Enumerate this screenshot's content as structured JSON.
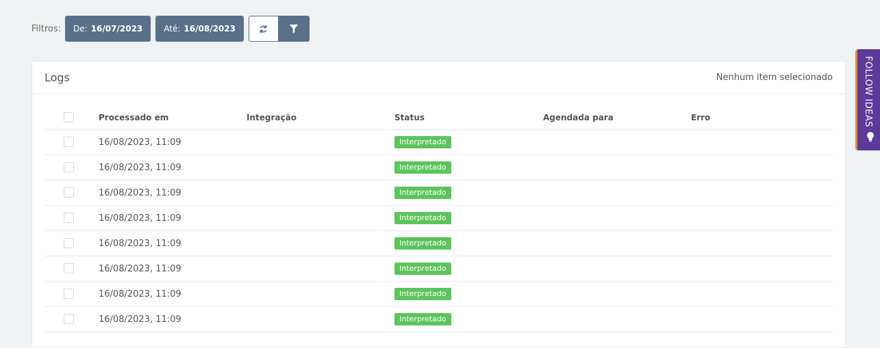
{
  "filters": {
    "label": "Filtros:",
    "from_prefix": "De:",
    "from_value": "16/07/2023",
    "to_prefix": "Até:",
    "to_value": "16/08/2023",
    "refresh_icon": "refresh-icon",
    "filter_icon": "funnel-icon"
  },
  "panel": {
    "title": "Logs",
    "selection_status": "Nenhum item selecionado"
  },
  "table": {
    "columns": {
      "processed": "Processado em",
      "integration": "Integração",
      "status": "Status",
      "scheduled": "Agendada para",
      "error": "Erro"
    },
    "rows": [
      {
        "processed": "16/08/2023, 11:09",
        "status": "Interpretado"
      },
      {
        "processed": "16/08/2023, 11:09",
        "status": "Interpretado"
      },
      {
        "processed": "16/08/2023, 11:09",
        "status": "Interpretado"
      },
      {
        "processed": "16/08/2023, 11:09",
        "status": "Interpretado"
      },
      {
        "processed": "16/08/2023, 11:09",
        "status": "Interpretado"
      },
      {
        "processed": "16/08/2023, 11:09",
        "status": "Interpretado"
      },
      {
        "processed": "16/08/2023, 11:09",
        "status": "Interpretado"
      },
      {
        "processed": "16/08/2023, 11:09",
        "status": "Interpretado"
      }
    ]
  },
  "follow_tab": {
    "label": "FOLLOW IDEAS",
    "icon": "lightbulb-icon"
  },
  "colors": {
    "primary": "#587089",
    "success": "#5cc45c",
    "follow_bg": "#5b3a9a",
    "follow_accent": "#e08a2c"
  }
}
